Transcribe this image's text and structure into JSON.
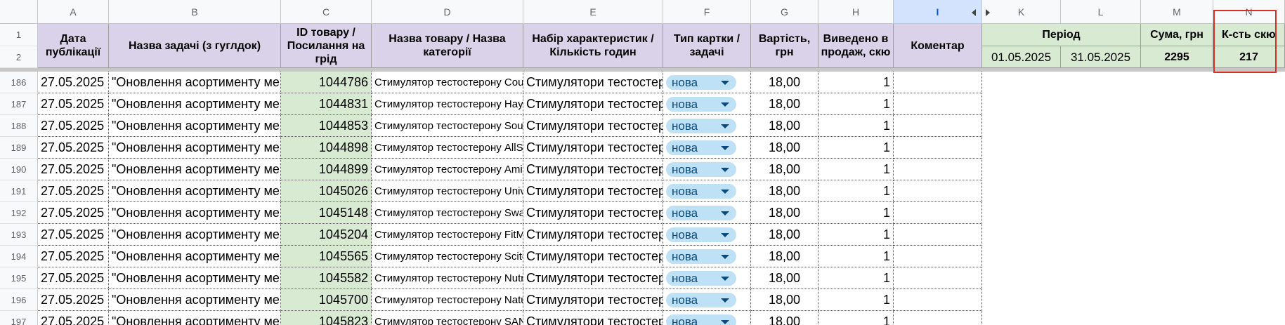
{
  "columns": [
    "A",
    "B",
    "C",
    "D",
    "E",
    "F",
    "G",
    "H",
    "I",
    "K",
    "L",
    "M",
    "N"
  ],
  "row_numbers_header": [
    "1",
    "2"
  ],
  "headers": {
    "date": "Дата публікації",
    "task": "Назва задачі (з гуглдок)",
    "id": "ID товару / Посилання на грід",
    "name": "Назва товару / Назва категорії",
    "chars": "Набір характеристик / Кількість годин",
    "type": "Тип картки / задачі",
    "cost": "Вартість, грн",
    "sold": "Виведено в продаж, скю",
    "comment": "Коментар",
    "period": "Період",
    "sum": "Сума, грн",
    "sku_count": "К-сть скю"
  },
  "summary": {
    "period_start": "01.05.2025",
    "period_end": "31.05.2025",
    "sum": "2295",
    "sku_count": "217"
  },
  "rows": [
    {
      "num": "186",
      "date": "27.05.2025",
      "task": "\"Оновлення асортименту мерч",
      "id": "1044786",
      "name": "Стимулятор тестостерону Cou",
      "chars": "Стимулятори тестостерону",
      "type": "нова",
      "cost": "18,00",
      "sold": "1"
    },
    {
      "num": "187",
      "date": "27.05.2025",
      "task": "\"Оновлення асортименту мерч",
      "id": "1044831",
      "name": "Стимулятор тестостерону Hay",
      "chars": "Стимулятори тестостерону",
      "type": "нова",
      "cost": "18,00",
      "sold": "1"
    },
    {
      "num": "188",
      "date": "27.05.2025",
      "task": "\"Оновлення асортименту мерч",
      "id": "1044853",
      "name": "Стимулятор тестостерону Sou",
      "chars": "Стимулятори тестостерону",
      "type": "нова",
      "cost": "18,00",
      "sold": "1"
    },
    {
      "num": "189",
      "date": "27.05.2025",
      "task": "\"Оновлення асортименту мерч",
      "id": "1044898",
      "name": "Стимулятор тестостерону AllS",
      "chars": "Стимулятори тестостерону",
      "type": "нова",
      "cost": "18,00",
      "sold": "1"
    },
    {
      "num": "190",
      "date": "27.05.2025",
      "task": "\"Оновлення асортименту мерч",
      "id": "1044899",
      "name": "Стимулятор тестостерону Ami",
      "chars": "Стимулятори тестостерону",
      "type": "нова",
      "cost": "18,00",
      "sold": "1"
    },
    {
      "num": "191",
      "date": "27.05.2025",
      "task": "\"Оновлення асортименту мерч",
      "id": "1045026",
      "name": "Стимулятор тестостерону Univ",
      "chars": "Стимулятори тестостерону",
      "type": "нова",
      "cost": "18,00",
      "sold": "1"
    },
    {
      "num": "192",
      "date": "27.05.2025",
      "task": "\"Оновлення асортименту мерч",
      "id": "1045148",
      "name": "Стимулятор тестостерону Swa",
      "chars": "Стимулятори тестостерону",
      "type": "нова",
      "cost": "18,00",
      "sold": "1"
    },
    {
      "num": "193",
      "date": "27.05.2025",
      "task": "\"Оновлення асортименту мерч",
      "id": "1045204",
      "name": "Стимулятор тестостерону FitM",
      "chars": "Стимулятори тестостерону",
      "type": "нова",
      "cost": "18,00",
      "sold": "1"
    },
    {
      "num": "194",
      "date": "27.05.2025",
      "task": "\"Оновлення асортименту мерч",
      "id": "1045565",
      "name": "Стимулятор тестостерону Scite",
      "chars": "Стимулятори тестостерону",
      "type": "нова",
      "cost": "18,00",
      "sold": "1"
    },
    {
      "num": "195",
      "date": "27.05.2025",
      "task": "\"Оновлення асортименту мерч",
      "id": "1045582",
      "name": "Стимулятор тестостерону Nutr",
      "chars": "Стимулятори тестостерону",
      "type": "нова",
      "cost": "18,00",
      "sold": "1"
    },
    {
      "num": "196",
      "date": "27.05.2025",
      "task": "\"Оновлення асортименту мерч",
      "id": "1045700",
      "name": "Стимулятор тестостерону Natu",
      "chars": "Стимулятори тестостерону",
      "type": "нова",
      "cost": "18,00",
      "sold": "1"
    },
    {
      "num": "197",
      "date": "27.05.2025",
      "task": "\"Оновлення асортименту мерч",
      "id": "1045823",
      "name": "Стимулятор тестостерону SAN",
      "chars": "Стимулятори тестостерону",
      "type": "нова",
      "cost": "18,00",
      "sold": "1"
    }
  ],
  "colors": {
    "header_purple": "#d9d2e9",
    "id_green": "#d9ead3",
    "chip_blue": "#bfe1f6",
    "highlight_red": "#d93025"
  },
  "icons": [
    "dropdown-arrow-icon",
    "collapse-left-icon",
    "expand-right-icon"
  ]
}
